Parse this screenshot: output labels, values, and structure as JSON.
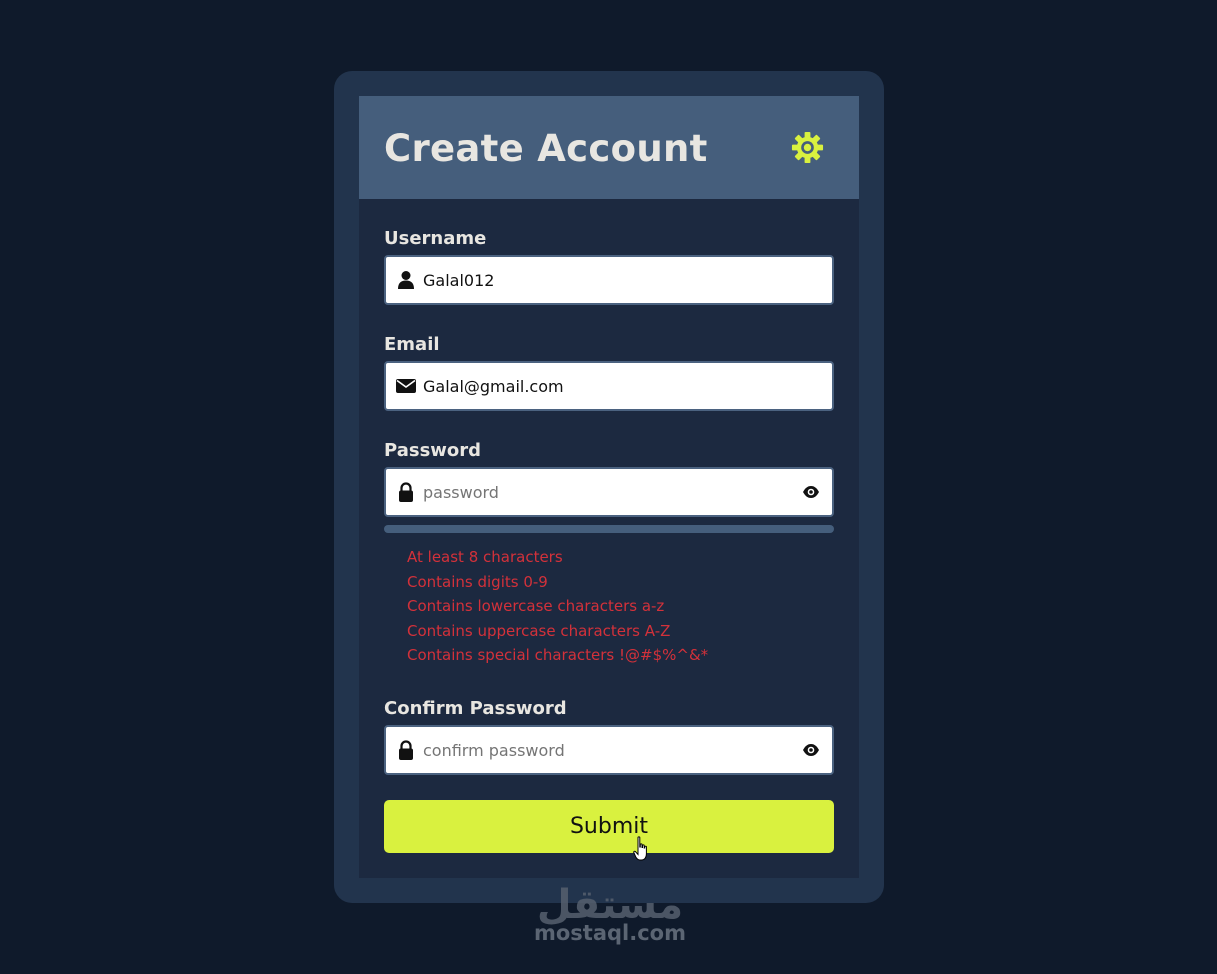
{
  "header": {
    "title": "Create Account",
    "accent_color": "#d9f13f"
  },
  "form": {
    "username": {
      "label": "Username",
      "value": "Galal012",
      "icon": "user-icon"
    },
    "email": {
      "label": "Email",
      "value": "Galal@gmail.com",
      "icon": "envelope-icon"
    },
    "password": {
      "label": "Password",
      "value": "",
      "placeholder": "password",
      "icon": "lock-icon",
      "toggle_icon": "eye-icon",
      "strength": 0
    },
    "requirements": [
      "At least 8 characters",
      "Contains digits 0-9",
      "Contains lowercase characters a-z",
      "Contains uppercase characters A-Z",
      "Contains special characters !@#$%^&*"
    ],
    "requirements_color": "#d3313a",
    "confirm_password": {
      "label": "Confirm Password",
      "value": "",
      "placeholder": "confirm password",
      "icon": "lock-icon",
      "toggle_icon": "eye-icon"
    },
    "submit_label": "Submit"
  },
  "watermark": {
    "logo_text": "مستقل",
    "url": "mostaql.com"
  }
}
